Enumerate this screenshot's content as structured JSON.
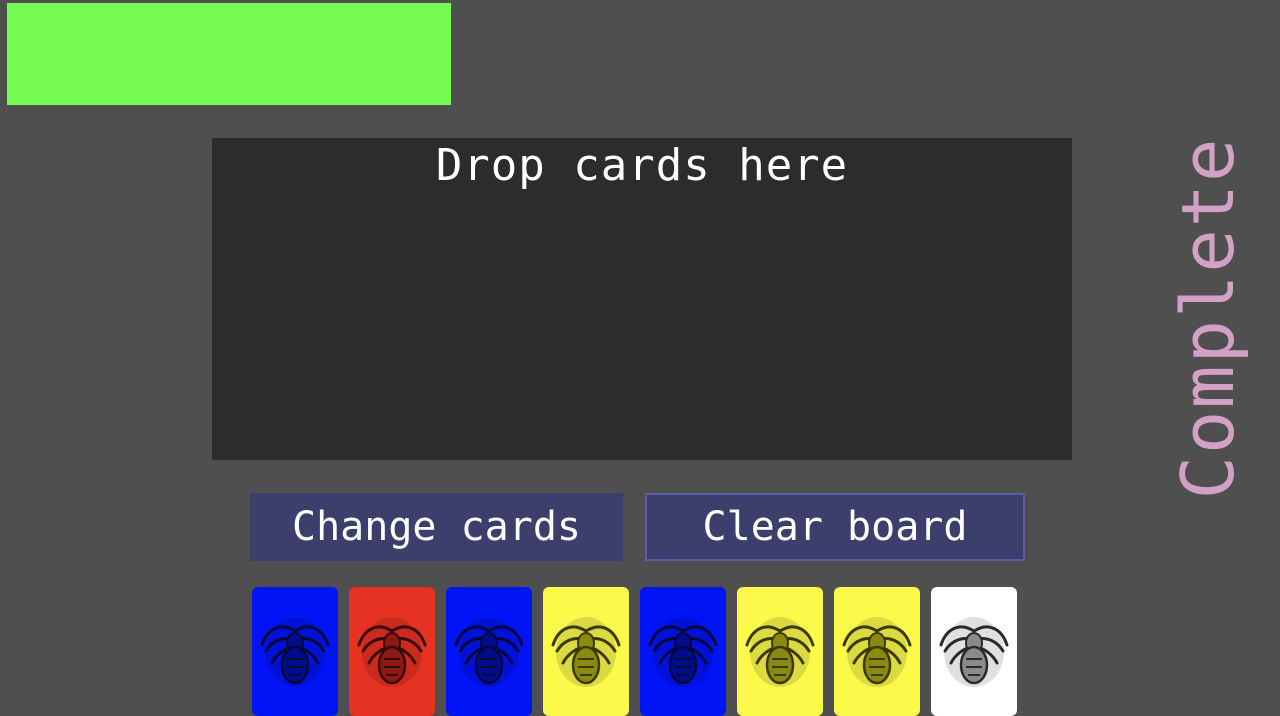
{
  "progress": {
    "fraction": 1.0,
    "color": "#77fc54"
  },
  "board": {
    "drop_label": "Drop cards here"
  },
  "buttons": {
    "change_cards": "Change cards",
    "clear_board": "Clear board"
  },
  "status": {
    "complete_label": "Complete",
    "color": "#d3a1c6"
  },
  "hand": {
    "card_icon": "creature-emblem-icon",
    "cards": [
      {
        "color": "blue",
        "hex": "#0014f5"
      },
      {
        "color": "red",
        "hex": "#e63222"
      },
      {
        "color": "blue",
        "hex": "#0014f5"
      },
      {
        "color": "yellow",
        "hex": "#fbf94a"
      },
      {
        "color": "blue",
        "hex": "#0014f5"
      },
      {
        "color": "yellow",
        "hex": "#fbf94a"
      },
      {
        "color": "yellow",
        "hex": "#fbf94a"
      },
      {
        "color": "white",
        "hex": "#ffffff"
      }
    ]
  }
}
